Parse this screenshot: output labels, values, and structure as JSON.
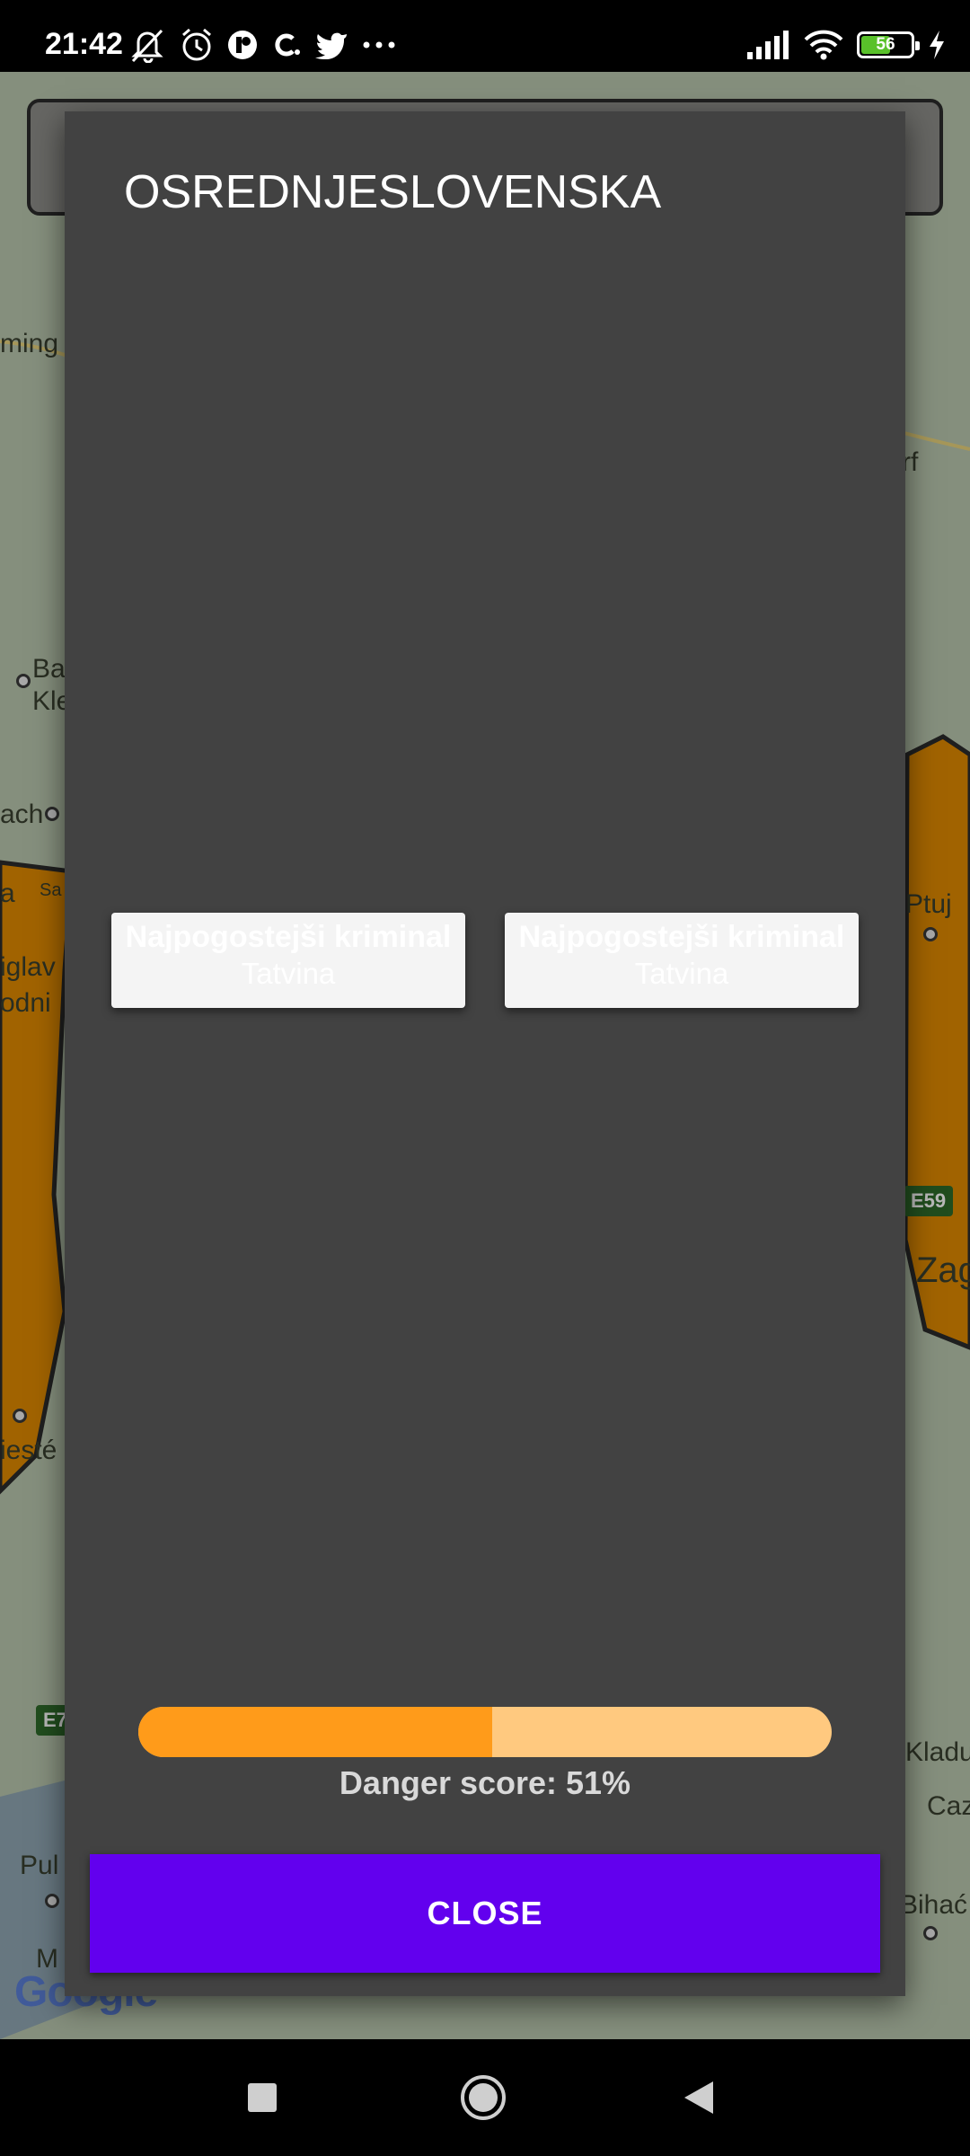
{
  "status_bar": {
    "time": "21:42",
    "left_icons": [
      "muted-bell-icon",
      "alarm-icon",
      "app-notification-icon",
      "c-notification-icon",
      "twitter-icon",
      "more-dots-icon"
    ],
    "right_icons": [
      "signal-icon",
      "wifi-icon",
      "battery-icon",
      "charging-icon"
    ],
    "battery_level": "56"
  },
  "map": {
    "labels": [
      "ming",
      "Ba",
      "Kle",
      "ach",
      "a",
      "Sa",
      "iglav",
      "odni",
      "iesté",
      "Pul",
      "M",
      "rf",
      "Ptuj",
      "Zag",
      "Kladu",
      "Caz",
      "Bihać"
    ],
    "road_shields": [
      "E59",
      "E7"
    ],
    "logo": "Google"
  },
  "dialog": {
    "title": "OSREDNJESLOVENSKA",
    "cards": [
      {
        "title": "Najpogostejši kriminal",
        "value": "Tatvina"
      },
      {
        "title": "Najpogostejši kriminal",
        "value": "Tatvina"
      }
    ],
    "danger": {
      "label": "Danger score: 51%",
      "fraction": 0.51,
      "fill_color": "#ff9b1a",
      "track_color": "#ffc97f"
    },
    "close_label": "CLOSE",
    "accent_color": "#6200ee"
  },
  "nav_bar": {
    "buttons": [
      "recents-square-icon",
      "home-circle-icon",
      "back-triangle-icon"
    ]
  }
}
